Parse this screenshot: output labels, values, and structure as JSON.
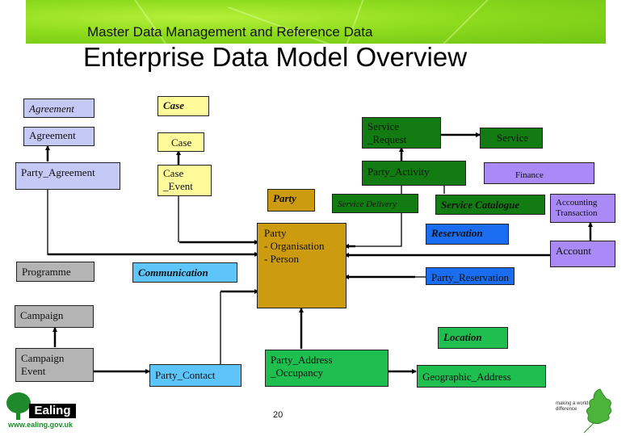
{
  "header": {
    "subtitle": "Master Data Management and Reference Data",
    "title": "Enterprise Data Model Overview"
  },
  "colors": {
    "agreement": "#c5c9f6",
    "case": "#fffb9a",
    "party": "#cc9b0f",
    "service": "#127b12",
    "finance": "#a98af6",
    "reservation": "#1a6cf0",
    "communication": "#5ec5fb",
    "campaign": "#b4b4b4",
    "location": "#1fbf4f"
  },
  "boxes": {
    "agreement_group": "Agreement",
    "agreement": "Agreement",
    "party_agreement": "Party_Agreement",
    "case_group": "Case",
    "case": "Case",
    "case_event": [
      "Case",
      "_Event"
    ],
    "party_group": "Party",
    "party": [
      "Party",
      "- Organisation",
      "- Person"
    ],
    "service_request": [
      "Service",
      "_Request"
    ],
    "service": "Service",
    "party_activity": "Party_Activity",
    "service_delivery": "Service Delivery",
    "service_catalogue": "Service Catalogue",
    "finance_group": "Finance",
    "accounting_transaction": [
      "Accounting",
      "Transaction"
    ],
    "account": "Account",
    "reservation_group": "Reservation",
    "party_reservation": "Party_Reservation",
    "programme": "Programme",
    "communication_group": "Communication",
    "campaign": "Campaign",
    "campaign_event": [
      "Campaign",
      "Event"
    ],
    "party_contact": "Party_Contact",
    "location_group": "Location",
    "party_address_occupancy": [
      "Party_Address",
      "_Occupancy"
    ],
    "geographic_address": "Geographic_Address"
  },
  "footer": {
    "page_number": "20",
    "logo_word": "Ealing",
    "logo_url": "www.ealing.gov.uk",
    "slogan": "making a world of difference"
  }
}
